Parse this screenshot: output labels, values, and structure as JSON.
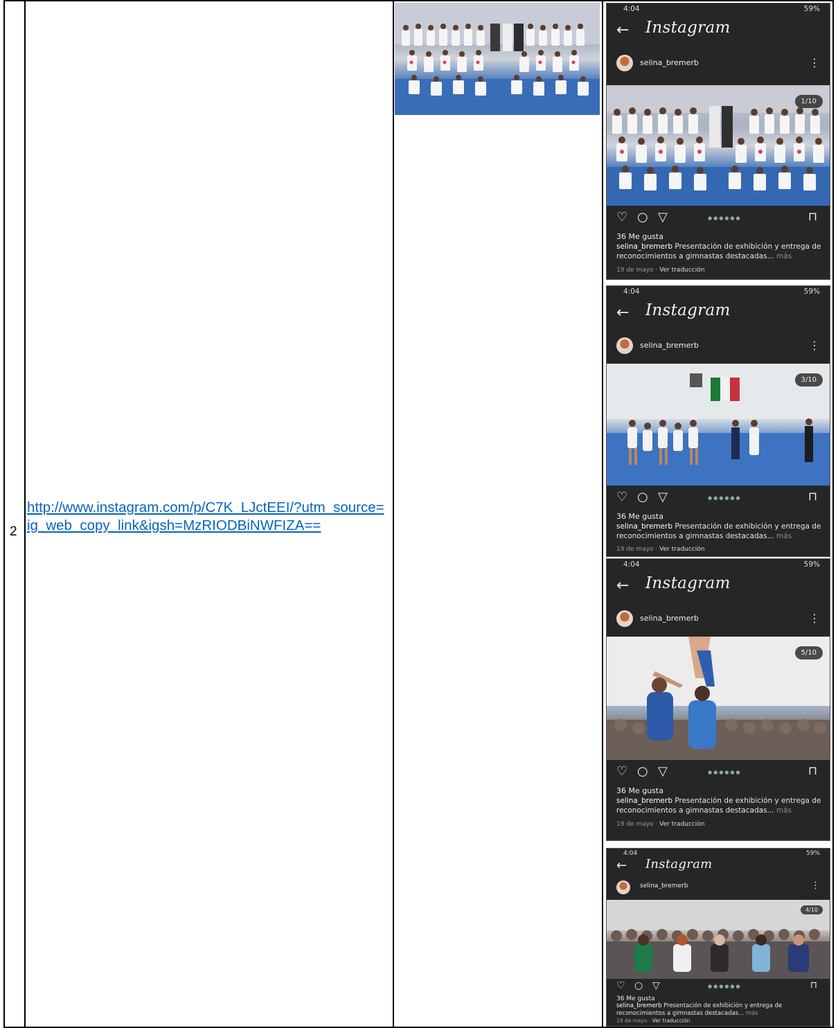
{
  "row": {
    "number": "2",
    "link_text": "http://www.instagram.com/p/C7K_LJctEEI/?utm_source=ig_web_copy_link&igsh=MzRIODBiNWFIZA=="
  },
  "screens": [
    {
      "status_time": "4:04",
      "status_right": "59%",
      "app_title": "Instagram",
      "username": "selina_bremerb",
      "counter": "1/10",
      "likes": "36 Me gusta",
      "caption_user": "selina_bremerb",
      "caption_text": "Presentación de exhibición y entrega de reconocimientos a gimnastas destacadas...",
      "more": "más",
      "date": "19 de mayo",
      "translate": "Ver traducción"
    },
    {
      "status_time": "4:04",
      "status_right": "59%",
      "app_title": "Instagram",
      "username": "selina_bremerb",
      "counter": "3/10",
      "likes": "36 Me gusta",
      "caption_user": "selina_bremerb",
      "caption_text": "Presentación de exhibición y entrega de reconocimientos a gimnastas destacadas...",
      "more": "más",
      "date": "19 de mayo",
      "translate": "Ver traducción"
    },
    {
      "status_time": "4:04",
      "status_right": "59%",
      "app_title": "Instagram",
      "username": "selina_bremerb",
      "counter": "5/10",
      "likes": "36 Me gusta",
      "caption_user": "selina_bremerb",
      "caption_text": "Presentación de exhibición y entrega de reconocimientos a gimnastas destacadas...",
      "more": "más",
      "date": "19 de mayo",
      "translate": "Ver traducción"
    },
    {
      "status_time": "4:04",
      "status_right": "59%",
      "app_title": "Instagram",
      "username": "selina_bremerb",
      "counter": "4/10",
      "likes": "36 Me gusta",
      "caption_user": "selina_bremerb",
      "caption_text": "Presentación de exhibición y entrega de reconocimientos a gimnastas destacadas...",
      "more": "más",
      "date": "19 de mayo",
      "translate": "Ver traducción"
    }
  ],
  "icons": {
    "back": "arrow-left-icon",
    "menu": "kebab-menu-icon",
    "like": "heart-icon",
    "comment": "comment-bubble-icon",
    "share": "send-icon",
    "save": "bookmark-icon"
  },
  "colors": {
    "link": "#0563C1",
    "phone_bg": "#262626"
  }
}
